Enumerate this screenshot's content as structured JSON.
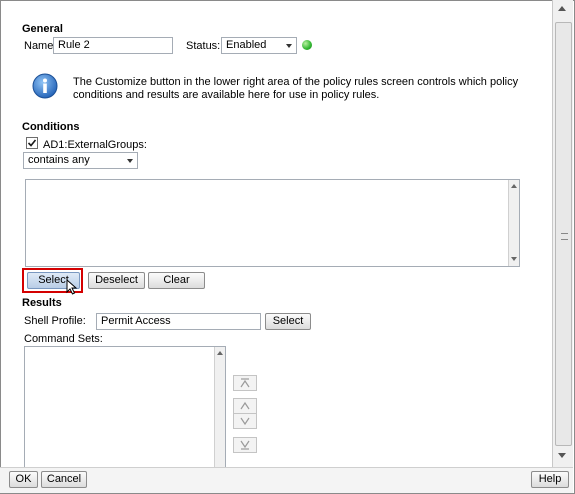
{
  "general": {
    "title": "General",
    "name_label": "Name:",
    "name_value": "Rule 2",
    "status_label": "Status:",
    "status_value": "Enabled",
    "status_color": "#2fb52f",
    "info_text_line1": "The Customize button in the lower right area of the policy rules screen controls which policy",
    "info_text_line2": "conditions and results are available here for use in policy rules."
  },
  "conditions": {
    "title": "Conditions",
    "checkbox_label": "AD1:ExternalGroups:",
    "operator_value": "contains any",
    "select_label": "Select",
    "deselect_label": "Deselect",
    "clear_label": "Clear"
  },
  "results": {
    "title": "Results",
    "shell_profile_label": "Shell Profile:",
    "shell_profile_value": "Permit Access",
    "select_label": "Select",
    "command_sets_label": "Command Sets:"
  },
  "footer": {
    "ok_label": "OK",
    "cancel_label": "Cancel",
    "help_label": "Help"
  },
  "colors": {
    "highlight_border": "#d40000",
    "info_icon": "#1f6fc8"
  }
}
